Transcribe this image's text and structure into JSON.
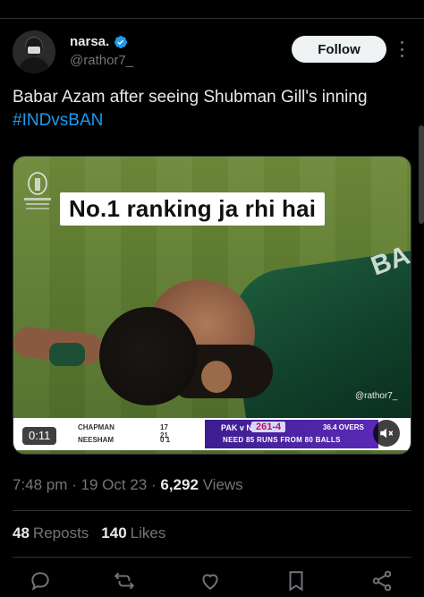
{
  "tweet": {
    "author": {
      "display_name": "narsa.",
      "handle": "@rathor7_",
      "verified": true
    },
    "follow_label": "Follow",
    "text": {
      "body": "Babar Azam after seeing Shubman Gill's inning ",
      "hashtag": "#INDvsBAN"
    },
    "media": {
      "caption": "No.1 ranking ja rhi hai",
      "watermark": "@rathor7_",
      "video_time": "0:11",
      "scoreboard": {
        "batter1": "CHAPMAN",
        "batter1_score": "17  21",
        "batter2": "NEESHAM",
        "batter2_score": "0   1",
        "teams": "PAK v NZ",
        "score": "261-4",
        "overs": "36.4 OVERS",
        "need": "NEED 85 RUNS FROM 80 BALLS"
      }
    },
    "timestamp": "7:48 pm · 19 Oct 23 · ",
    "views_count": "6,292",
    "views_label": " Views",
    "reposts_count": "48",
    "reposts_label": "Reposts",
    "likes_count": "140",
    "likes_label": "Likes"
  },
  "colors": {
    "accent": "#1d9bf0",
    "background": "#000000",
    "muted": "#71767b"
  }
}
